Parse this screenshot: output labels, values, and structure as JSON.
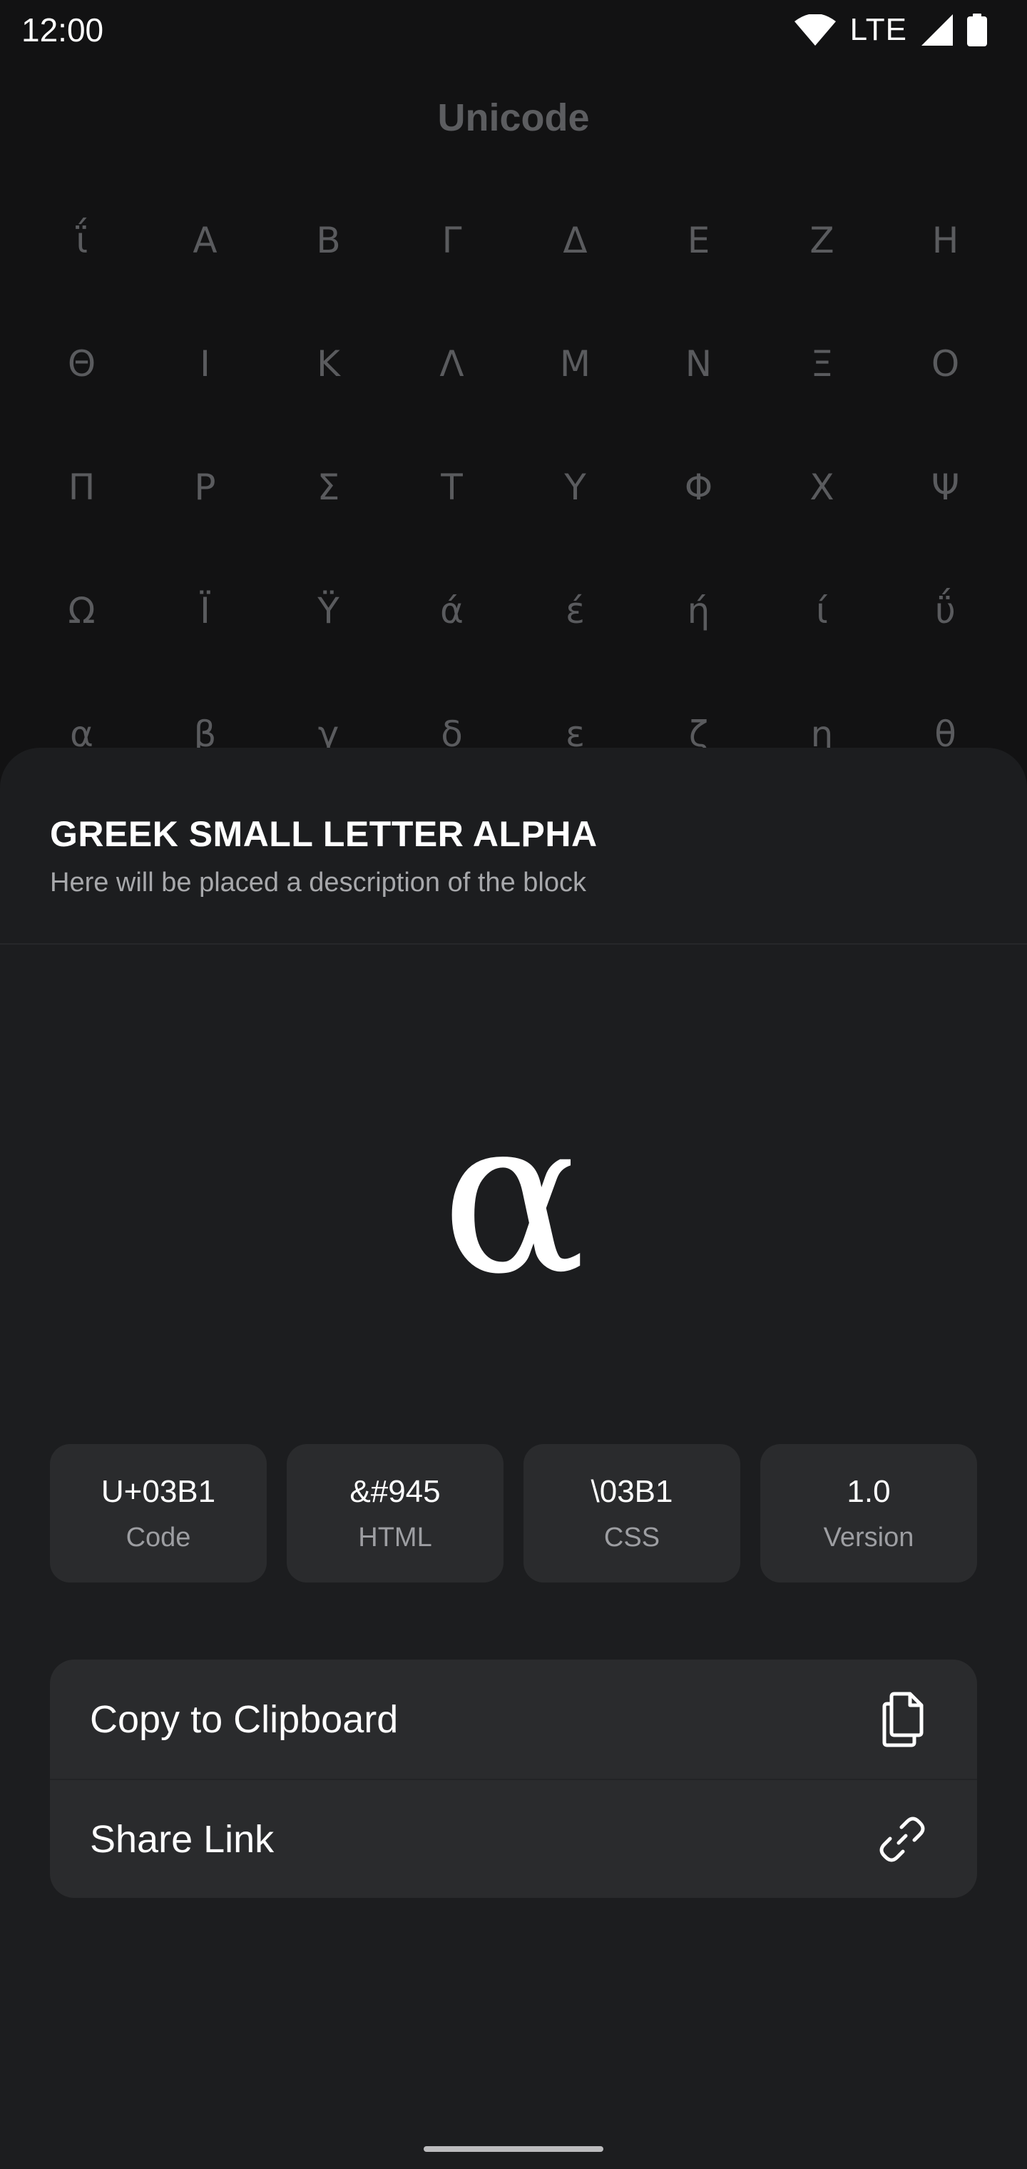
{
  "status_bar": {
    "time": "12:00",
    "network": "LTE",
    "icons": [
      "wifi-icon",
      "signal-icon",
      "battery-icon"
    ]
  },
  "background": {
    "title": "Unicode",
    "grid": [
      "ΐ",
      "Α",
      "Β",
      "Γ",
      "Δ",
      "Ε",
      "Ζ",
      "Η",
      "Θ",
      "Ι",
      "Κ",
      "Λ",
      "Μ",
      "Ν",
      "Ξ",
      "Ο",
      "Π",
      "Ρ",
      "Σ",
      "Τ",
      "Υ",
      "Φ",
      "Χ",
      "Ψ",
      "Ω",
      "Ϊ",
      "Ϋ",
      "ά",
      "έ",
      "ή",
      "ί",
      "ΰ",
      "α",
      "β",
      "γ",
      "δ",
      "ε",
      "ζ",
      "η",
      "θ"
    ]
  },
  "sheet": {
    "title": "GREEK SMALL LETTER ALPHA",
    "subtitle": "Here will be placed a description of the block",
    "glyph": "α",
    "info": [
      {
        "value": "U+03B1",
        "label": "Code"
      },
      {
        "value": "&#945",
        "label": "HTML"
      },
      {
        "value": "\\03B1",
        "label": "CSS"
      },
      {
        "value": "1.0",
        "label": "Version"
      }
    ],
    "actions": [
      {
        "label": "Copy to Clipboard",
        "icon": "copy-icon"
      },
      {
        "label": "Share Link",
        "icon": "link-icon"
      }
    ]
  },
  "colors": {
    "background": "#121213",
    "sheet": "#1c1d1f",
    "card": "#2a2b2d",
    "text_primary": "#ffffff",
    "text_secondary": "#a7a8ab"
  }
}
